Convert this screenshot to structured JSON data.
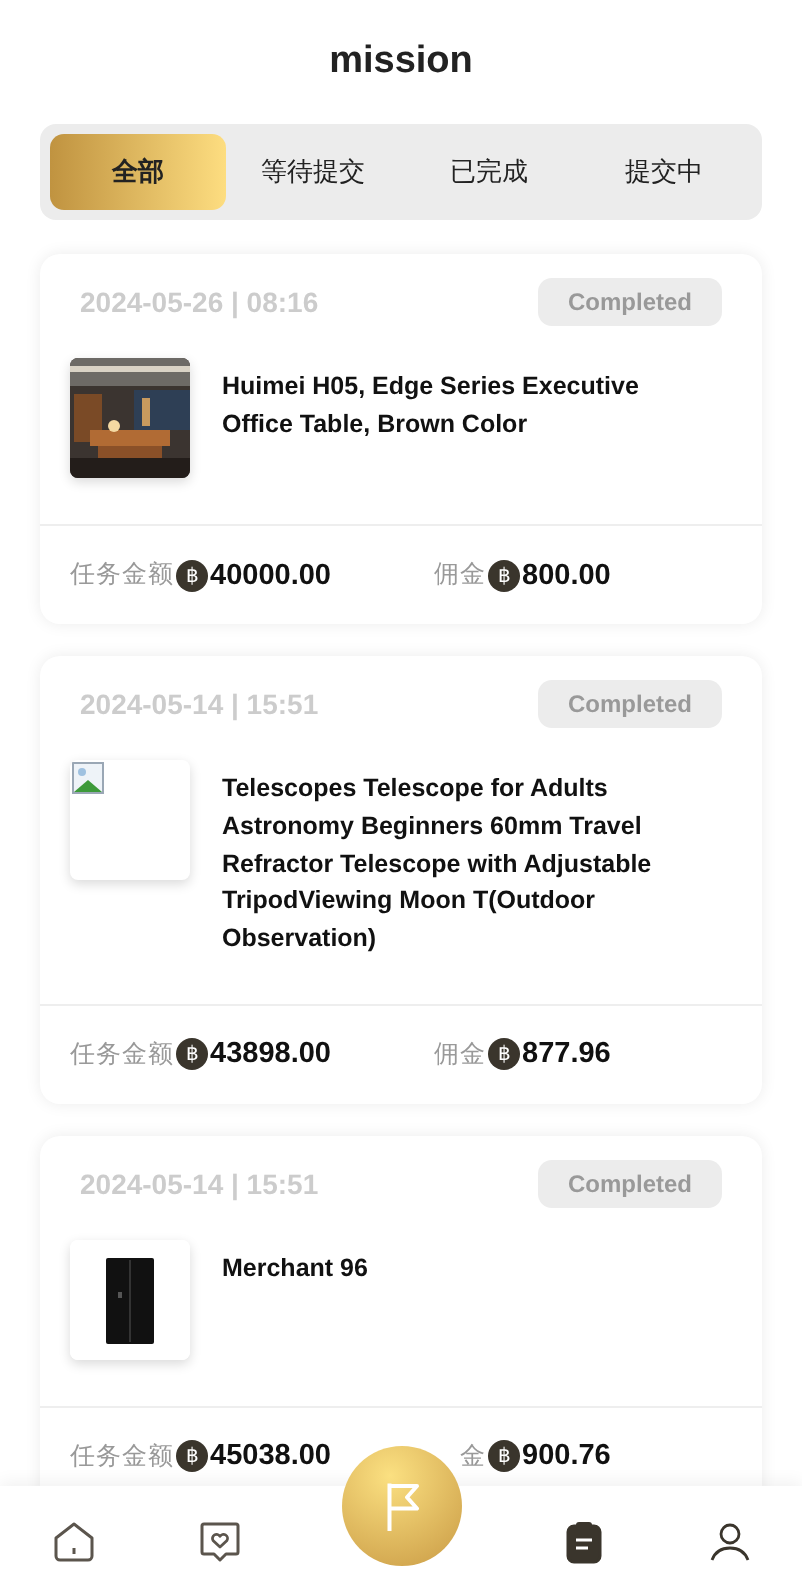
{
  "title": "mission",
  "tabs": [
    {
      "label": "全部",
      "selected": true
    },
    {
      "label": "等待提交",
      "selected": false
    },
    {
      "label": "已完成",
      "selected": false
    },
    {
      "label": "提交中",
      "selected": false
    }
  ],
  "orders": [
    {
      "time": "2024-05-26 | 08:16",
      "status": "Completed",
      "kind": "picture",
      "name": "Huimei H05, Edge Series Executive Office Table, Brown Color",
      "amount_label": "任务金额",
      "currency": "฿",
      "amount": "40000.00",
      "commission_label": "佣金",
      "commission_currency": "฿",
      "commission": "800.00"
    },
    {
      "time": "2024-05-14 | 15:51",
      "status": "Completed",
      "kind": "broken",
      "name": "Telescopes Telescope for Adults Astronomy Beginners 60mm Travel Refractor Telescope with Adjustable TripodViewing Moon T(Outdoor Observation)",
      "amount_label": "任务金额",
      "currency": "฿",
      "amount": "43898.00",
      "commission_label": "佣金",
      "commission_currency": "฿",
      "commission": "877.96"
    },
    {
      "time": "2024-05-14 | 15:51",
      "status": "Completed",
      "kind": "picture",
      "name": "Merchant 96",
      "amount_label": "任务金额",
      "currency": "฿",
      "amount": "45038.00",
      "commission_label": "金",
      "commission_currency": "฿",
      "commission": "900.76"
    }
  ],
  "nav": [
    {
      "kind": "home",
      "selected": false
    },
    {
      "kind": "chat",
      "selected": false
    },
    {
      "kind": "flag",
      "selected": false
    },
    {
      "kind": "clipboard",
      "selected": true
    },
    {
      "kind": "user",
      "selected": false
    }
  ]
}
